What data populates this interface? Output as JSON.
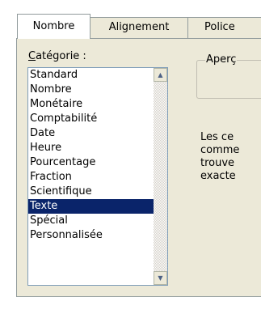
{
  "tabs": [
    {
      "label": "Nombre",
      "active": true
    },
    {
      "label": "Alignement",
      "active": false
    },
    {
      "label": "Police",
      "active": false
    }
  ],
  "category": {
    "label_first": "C",
    "label_rest": "atégorie :",
    "items": [
      {
        "label": "Standard"
      },
      {
        "label": "Nombre"
      },
      {
        "label": "Monétaire"
      },
      {
        "label": "Comptabilité"
      },
      {
        "label": "Date"
      },
      {
        "label": "Heure"
      },
      {
        "label": "Pourcentage"
      },
      {
        "label": "Fraction"
      },
      {
        "label": "Scientifique"
      },
      {
        "label": "Texte"
      },
      {
        "label": "Spécial"
      },
      {
        "label": "Personnalisée"
      }
    ],
    "selected": "Texte"
  },
  "preview": {
    "legend": "Aperç"
  },
  "description": [
    "Les ce",
    "comme",
    "trouve",
    "exacte"
  ],
  "colors": {
    "selection": "#0a246a",
    "panel": "#ece9d8",
    "border": "#919b9c"
  },
  "icons": {
    "scroll_up": "scroll-up-arrow-icon",
    "scroll_down": "scroll-down-arrow-icon"
  }
}
